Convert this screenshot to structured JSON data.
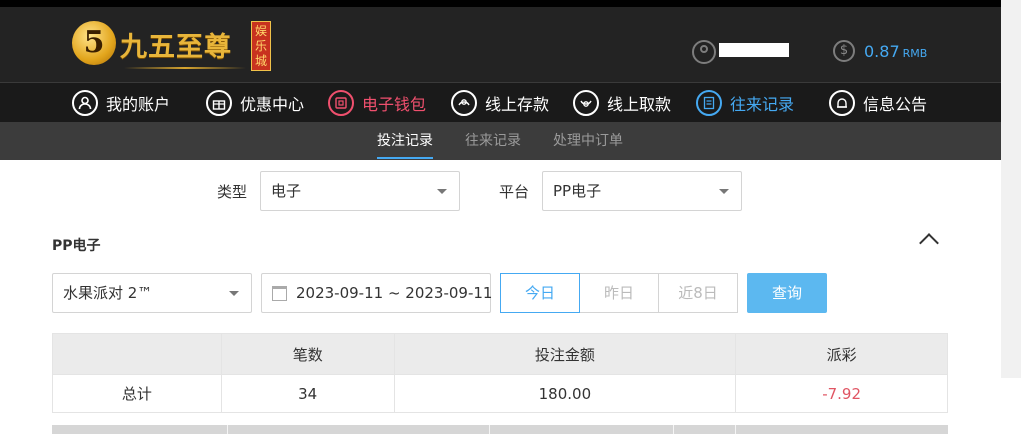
{
  "header": {
    "logo_badge": "5",
    "logo_text": "九五至尊",
    "logo_tag": "娱乐城",
    "balance": "0.87",
    "balance_unit": "RMB"
  },
  "nav": {
    "items": [
      {
        "label": "我的账户",
        "icon": "user-circle-icon",
        "state": "normal"
      },
      {
        "label": "优惠中心",
        "icon": "gift-icon",
        "state": "normal"
      },
      {
        "label": "电子钱包",
        "icon": "wallet-icon",
        "state": "red"
      },
      {
        "label": "线上存款",
        "icon": "deposit-icon",
        "state": "normal"
      },
      {
        "label": "线上取款",
        "icon": "withdraw-icon",
        "state": "normal"
      },
      {
        "label": "往来记录",
        "icon": "records-icon",
        "state": "blue"
      },
      {
        "label": "信息公告",
        "icon": "bell-icon",
        "state": "normal"
      }
    ]
  },
  "subtabs": [
    {
      "label": "投注记录",
      "active": true
    },
    {
      "label": "往来记录",
      "active": false
    },
    {
      "label": "处理中订单",
      "active": false
    }
  ],
  "filters": {
    "type_label": "类型",
    "type_value": "电子",
    "platform_label": "平台",
    "platform_value": "PP电子"
  },
  "section": {
    "title": "PP电子",
    "game_value": "水果派对 2™",
    "date_range": "2023-09-11 ~ 2023-09-11",
    "ranges": [
      "今日",
      "昨日",
      "近8日"
    ],
    "active_range": "今日",
    "query_label": "查询"
  },
  "summary": {
    "headers": [
      "",
      "笔数",
      "投注金额",
      "派彩"
    ],
    "row": {
      "label": "总计",
      "count": "34",
      "amount": "180.00",
      "payout": "-7.92"
    }
  },
  "colors": {
    "accent_blue": "#45a9f2",
    "accent_red": "#f0506e",
    "negative": "#e05563"
  }
}
